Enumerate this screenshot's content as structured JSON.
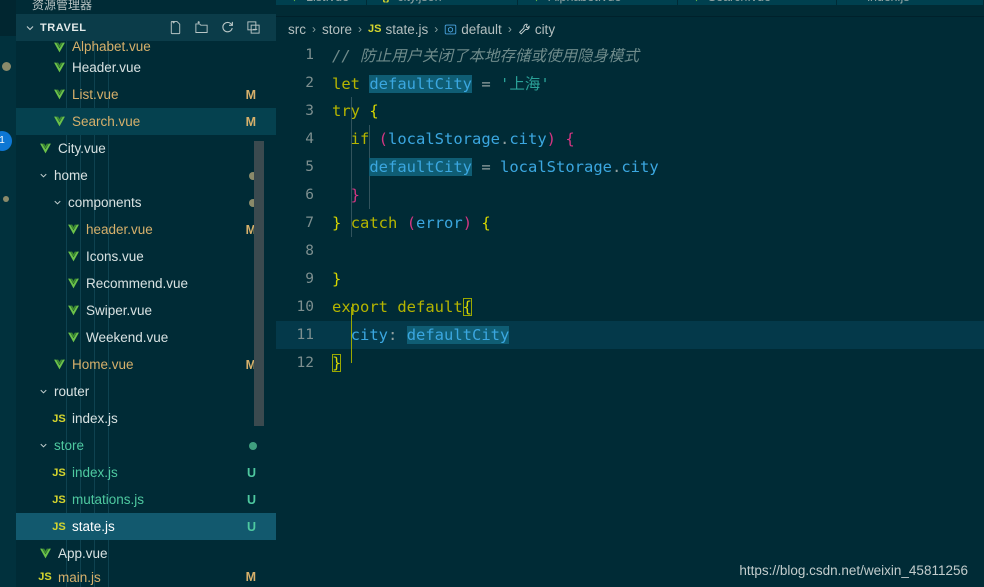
{
  "activity_bar": {
    "badge_count": "1"
  },
  "sidebar": {
    "explorer_label": "资源管理器",
    "section": {
      "title": "TRAVEL",
      "chevron": "chevron-down-icon",
      "actions": [
        {
          "name": "new-file-icon",
          "tooltip": "New File"
        },
        {
          "name": "new-folder-icon",
          "tooltip": "New Folder"
        },
        {
          "name": "refresh-icon",
          "tooltip": "Refresh Explorer"
        },
        {
          "name": "collapse-all-icon",
          "tooltip": "Collapse Folders in Explorer"
        }
      ]
    },
    "items": [
      {
        "label": "Alphabet.vue",
        "type": "file",
        "icon": "vue-icon",
        "indent": 3,
        "status": "",
        "color": "mod",
        "clipped": true
      },
      {
        "label": "Header.vue",
        "type": "file",
        "icon": "vue-icon",
        "indent": 3,
        "status": "",
        "color": "white"
      },
      {
        "label": "List.vue",
        "type": "file",
        "icon": "vue-icon",
        "indent": 3,
        "status": "M",
        "color": "mod"
      },
      {
        "label": "Search.vue",
        "type": "file",
        "icon": "vue-icon",
        "indent": 3,
        "status": "M",
        "color": "mod",
        "state": "hovered"
      },
      {
        "label": "City.vue",
        "type": "file",
        "icon": "vue-icon",
        "indent": 2,
        "status": "",
        "color": "white"
      },
      {
        "label": "home",
        "type": "folder",
        "icon": "chevron-down-icon",
        "indent": 2,
        "status": "dot",
        "color": "white"
      },
      {
        "label": "components",
        "type": "folder",
        "icon": "chevron-down-icon",
        "indent": 3,
        "status": "dot",
        "color": "white"
      },
      {
        "label": "header.vue",
        "type": "file",
        "icon": "vue-icon",
        "indent": 4,
        "status": "M",
        "color": "mod"
      },
      {
        "label": "Icons.vue",
        "type": "file",
        "icon": "vue-icon",
        "indent": 4,
        "status": "",
        "color": "white"
      },
      {
        "label": "Recommend.vue",
        "type": "file",
        "icon": "vue-icon",
        "indent": 4,
        "status": "",
        "color": "white"
      },
      {
        "label": "Swiper.vue",
        "type": "file",
        "icon": "vue-icon",
        "indent": 4,
        "status": "",
        "color": "white"
      },
      {
        "label": "Weekend.vue",
        "type": "file",
        "icon": "vue-icon",
        "indent": 4,
        "status": "",
        "color": "white"
      },
      {
        "label": "Home.vue",
        "type": "file",
        "icon": "vue-icon",
        "indent": 3,
        "status": "M",
        "color": "mod"
      },
      {
        "label": "router",
        "type": "folder",
        "icon": "chevron-down-icon",
        "indent": 2,
        "status": "",
        "color": "white"
      },
      {
        "label": "index.js",
        "type": "file",
        "icon": "js-icon",
        "indent": 3,
        "status": "",
        "color": "white"
      },
      {
        "label": "store",
        "type": "folder",
        "icon": "chevron-down-icon",
        "indent": 2,
        "status": "dot-u",
        "color": "untracked"
      },
      {
        "label": "index.js",
        "type": "file",
        "icon": "js-icon",
        "indent": 3,
        "status": "U",
        "color": "untracked"
      },
      {
        "label": "mutations.js",
        "type": "file",
        "icon": "js-icon",
        "indent": 3,
        "status": "U",
        "color": "untracked"
      },
      {
        "label": "state.js",
        "type": "file",
        "icon": "js-icon",
        "indent": 3,
        "status": "U",
        "color": "untracked",
        "state": "selected"
      },
      {
        "label": "App.vue",
        "type": "file",
        "icon": "vue-icon",
        "indent": 2,
        "status": "",
        "color": "white"
      },
      {
        "label": "main.js",
        "type": "file",
        "icon": "js-icon",
        "indent": 2,
        "status": "M",
        "color": "mod",
        "clipped_bottom": true
      }
    ]
  },
  "editor": {
    "tabs": [
      {
        "label": "List.vue",
        "icon": "vue-icon"
      },
      {
        "label": "city.json",
        "icon": "json-icon"
      },
      {
        "label": "Alphabet.vue",
        "icon": "vue-icon"
      },
      {
        "label": "Search.vue",
        "icon": "vue-icon"
      },
      {
        "label": "index.js",
        "icon": "js-icon"
      }
    ],
    "breadcrumb": [
      {
        "label": "src",
        "icon": ""
      },
      {
        "label": "store",
        "icon": ""
      },
      {
        "label": "state.js",
        "icon": "js-icon"
      },
      {
        "label": "default",
        "icon": "module-icon"
      },
      {
        "label": "city",
        "icon": "wrench-icon"
      }
    ],
    "breadcrumb_separator": "›",
    "filename": "state.js",
    "language": "javascript",
    "active_line": 11,
    "lines": [
      {
        "n": "1",
        "tokens": [
          {
            "t": "// 防止用户关闭了本地存储或使用隐身模式",
            "c": "com"
          }
        ]
      },
      {
        "n": "2",
        "tokens": [
          {
            "t": "let ",
            "c": "kw"
          },
          {
            "t": "defaultCity",
            "c": "var",
            "sel": true
          },
          {
            "t": " ",
            "c": "plain"
          },
          {
            "t": "=",
            "c": "op"
          },
          {
            "t": " ",
            "c": "plain"
          },
          {
            "t": "'上海'",
            "c": "str"
          }
        ]
      },
      {
        "n": "3",
        "tokens": [
          {
            "t": "try ",
            "c": "kw"
          },
          {
            "t": "{",
            "c": "br1"
          }
        ]
      },
      {
        "n": "4",
        "tokens": [
          {
            "t": "  if ",
            "c": "kw"
          },
          {
            "t": "(",
            "c": "br2"
          },
          {
            "t": "localStorage",
            "c": "var"
          },
          {
            "t": ".",
            "c": "op"
          },
          {
            "t": "city",
            "c": "var"
          },
          {
            "t": ")",
            "c": "br2"
          },
          {
            "t": " ",
            "c": "plain"
          },
          {
            "t": "{",
            "c": "br2"
          }
        ]
      },
      {
        "n": "5",
        "tokens": [
          {
            "t": "    ",
            "c": "plain"
          },
          {
            "t": "defaultCity",
            "c": "var",
            "sel": true
          },
          {
            "t": " ",
            "c": "plain"
          },
          {
            "t": "=",
            "c": "op"
          },
          {
            "t": " ",
            "c": "plain"
          },
          {
            "t": "localStorage",
            "c": "var"
          },
          {
            "t": ".",
            "c": "op"
          },
          {
            "t": "city",
            "c": "var"
          }
        ]
      },
      {
        "n": "6",
        "tokens": [
          {
            "t": "  ",
            "c": "plain"
          },
          {
            "t": "}",
            "c": "br2"
          }
        ]
      },
      {
        "n": "7",
        "tokens": [
          {
            "t": "}",
            "c": "br1"
          },
          {
            "t": " ",
            "c": "plain"
          },
          {
            "t": "catch ",
            "c": "kw"
          },
          {
            "t": "(",
            "c": "br2"
          },
          {
            "t": "error",
            "c": "var"
          },
          {
            "t": ")",
            "c": "br2"
          },
          {
            "t": " ",
            "c": "plain"
          },
          {
            "t": "{",
            "c": "br1"
          }
        ]
      },
      {
        "n": "8",
        "tokens": [
          {
            "t": "",
            "c": "plain"
          }
        ]
      },
      {
        "n": "9",
        "tokens": [
          {
            "t": "}",
            "c": "br1"
          }
        ]
      },
      {
        "n": "10",
        "tokens": [
          {
            "t": "export ",
            "c": "kw"
          },
          {
            "t": "default",
            "c": "kw"
          },
          {
            "t": "{",
            "c": "br1",
            "box": true
          }
        ]
      },
      {
        "n": "11",
        "tokens": [
          {
            "t": "  ",
            "c": "plain"
          },
          {
            "t": "city",
            "c": "prop"
          },
          {
            "t": ":",
            "c": "op"
          },
          {
            "t": " ",
            "c": "plain"
          },
          {
            "t": "defaultCity",
            "c": "var",
            "sel": true
          }
        ]
      },
      {
        "n": "12",
        "tokens": [
          {
            "t": "}",
            "c": "br1",
            "box": true
          }
        ]
      }
    ]
  },
  "watermark": "https://blog.csdn.net/weixin_45811256"
}
